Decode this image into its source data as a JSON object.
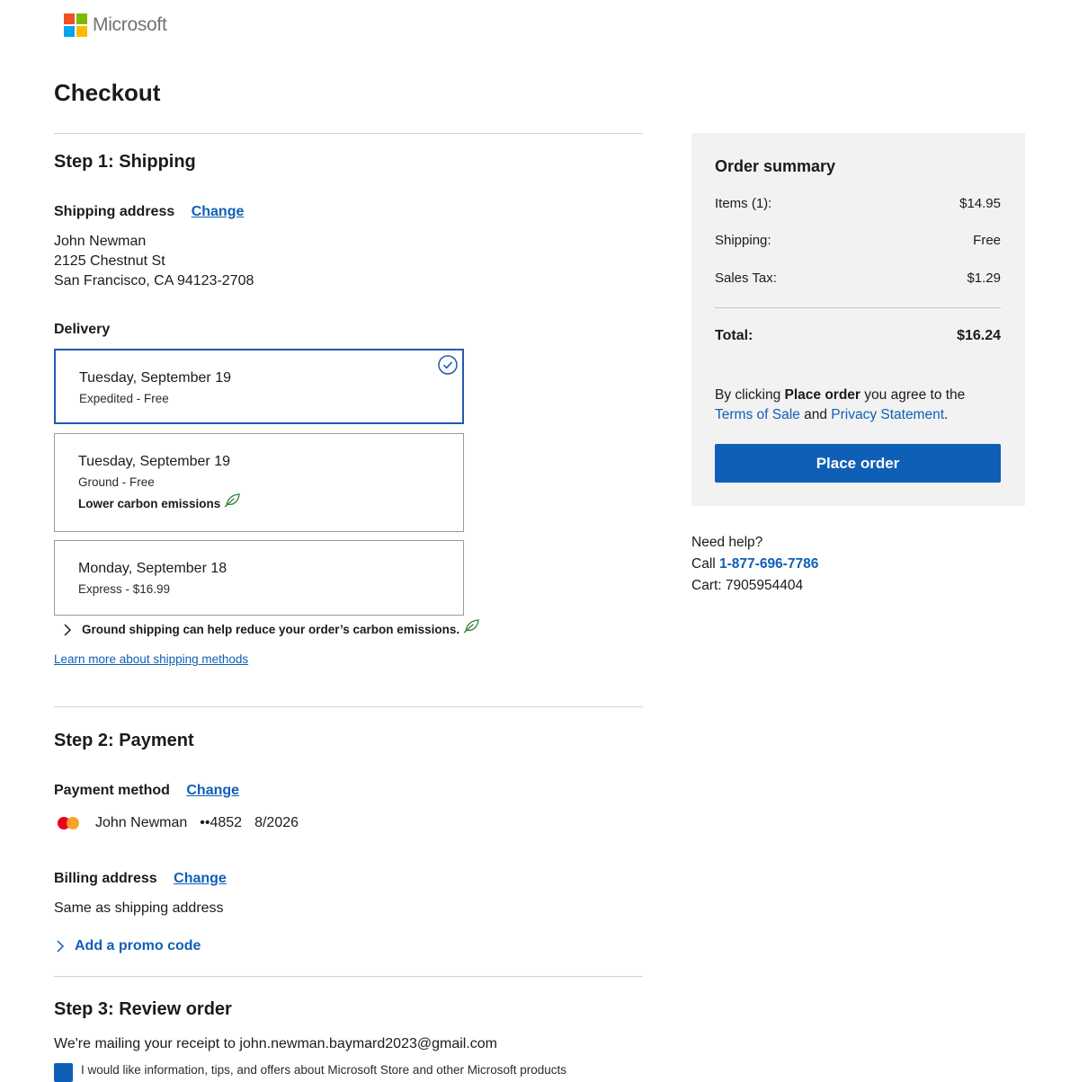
{
  "brand": {
    "name": "Microsoft",
    "colors": [
      "#f25022",
      "#7fba00",
      "#00a4ef",
      "#ffb900"
    ]
  },
  "page": {
    "title": "Checkout"
  },
  "step1": {
    "title": "Step 1: Shipping",
    "shipping_label": "Shipping address",
    "change_label": "Change",
    "address": {
      "name": "John Newman",
      "street": "2125 Chestnut St",
      "city": "San Francisco, CA 94123-2708"
    },
    "delivery_label": "Delivery",
    "options": [
      {
        "date": "Tuesday, September 19",
        "detail": "Expedited - Free",
        "selected": true
      },
      {
        "date": "Tuesday, September 19",
        "detail": "Ground - Free",
        "note": "Lower carbon emissions"
      },
      {
        "date": "Monday, September 18",
        "detail": "Express - $16.99"
      }
    ],
    "accordion_text": "Ground shipping can help reduce your order’s carbon emissions.",
    "learn_more": "Learn more about shipping methods"
  },
  "step2": {
    "title": "Step 2: Payment",
    "payment_label": "Payment method",
    "change_label": "Change",
    "card": {
      "holder": "John Newman",
      "number": "••4852",
      "expiry": "8/2026",
      "brand_icon": "mastercard-icon"
    },
    "billing_label": "Billing address",
    "billing_change": "Change",
    "billing_value": "Same as shipping address",
    "promo": "Add a promo code"
  },
  "step3": {
    "title": "Step 3: Review order",
    "receipt": "We're mailing your receipt to john.newman.baymard2023@gmail.com",
    "optin": "I would like information, tips, and offers about Microsoft Store and other Microsoft products"
  },
  "summary": {
    "title": "Order summary",
    "items_label": "Items (1):",
    "items_value": "$14.95",
    "shipping_label": "Shipping:",
    "shipping_value": "Free",
    "tax_label": "Sales Tax:",
    "tax_value": "$1.29",
    "total_label": "Total:",
    "total_value": "$16.24",
    "agree_prefix": "By clicking ",
    "agree_bold": "Place order",
    "agree_mid": " you agree to the",
    "terms": "Terms of Sale",
    "and": " and ",
    "privacy": "Privacy Statement",
    "period": ".",
    "button": "Place order"
  },
  "help": {
    "title": "Need help?",
    "call_prefix": "Call ",
    "phone": "1-877-696-7786",
    "cart": "Cart: 7905954404"
  },
  "colors": {
    "accent": "#0f5fb7",
    "selected_border": "#2458b1",
    "leaf": "#2e7d32"
  }
}
